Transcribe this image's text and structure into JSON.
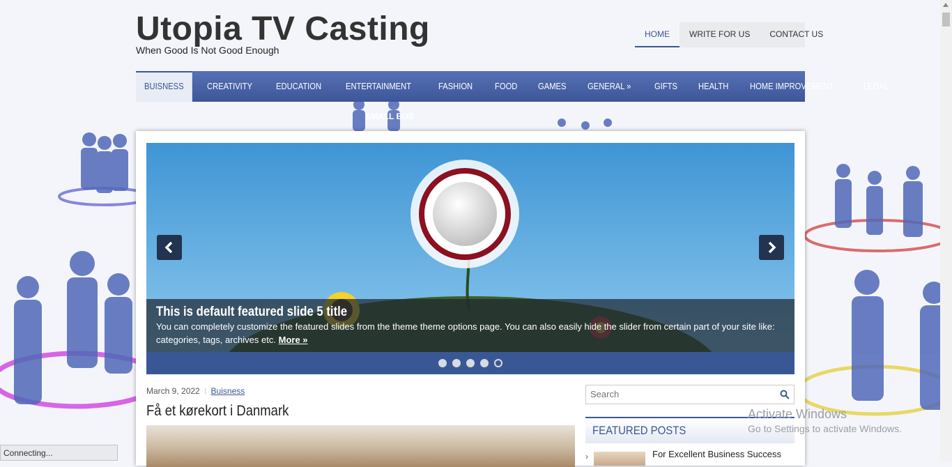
{
  "site": {
    "title": "Utopia TV Casting",
    "tagline": "When Good Is Not Good Enough"
  },
  "top_nav": [
    "HOME",
    "WRITE FOR US",
    "CONTACT US"
  ],
  "main_nav": [
    "BUISNESS",
    "CREATIVITY",
    "EDUCATION",
    "ENTERTAINMENT",
    "FASHION",
    "FOOD",
    "GAMES",
    "GENERAL  »",
    "GIFTS",
    "HEALTH",
    "HOME IMPROVEMENT",
    "LEGAL"
  ],
  "submenu_peek": "SMALL BUS",
  "slider": {
    "title": "This is default featured slide 5 title",
    "text": "You can completely customize the featured slides from the theme theme options page. You can also easily hide the slider from certain part of your site like: categories, tags, archives etc.",
    "more": "More »",
    "dot_count": 5,
    "active_dot": 5
  },
  "post": {
    "date": "March 9, 2022",
    "category": "Buisness",
    "title": "Få et kørekort i Danmark"
  },
  "sidebar": {
    "search_placeholder": "Search",
    "featured_title": "FEATURED POSTS",
    "featured_items": [
      "For Excellent Business Success"
    ]
  },
  "watermark": {
    "line1": "Activate Windows",
    "line2": "Go to Settings to activate Windows."
  },
  "status": "Connecting...",
  "colors": {
    "accent": "#3a5795",
    "nav_gradient_top": "#5671b5",
    "nav_gradient_bottom": "#3d5699"
  }
}
